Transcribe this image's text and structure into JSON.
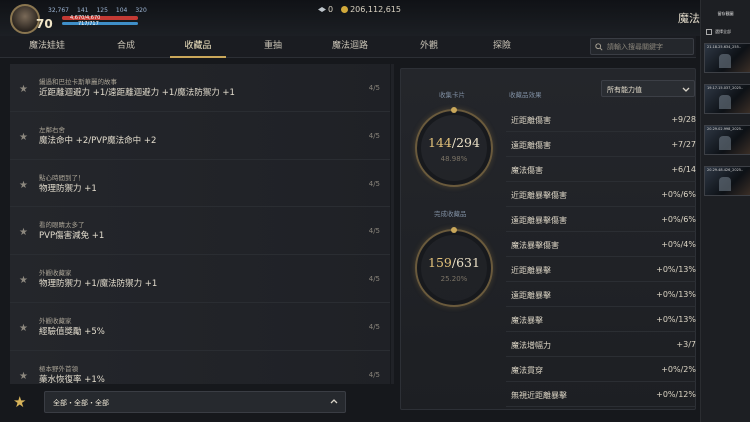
{
  "hud": {
    "level": "70",
    "stat_1": "32,767",
    "stat_2": "141",
    "stat_3": "125",
    "stat_4": "104",
    "stat_5": "320",
    "hp_text": "4,670/4,670",
    "hp_fraction": 1.0,
    "mp_text": "717/717",
    "mp_fraction": 1.0,
    "diamonds": "0",
    "gold": "206,112,615",
    "page_title": "魔法"
  },
  "tabs": [
    {
      "label": "魔法娃娃",
      "active": false
    },
    {
      "label": "合成",
      "active": false
    },
    {
      "label": "收藏品",
      "active": true
    },
    {
      "label": "重抽",
      "active": false
    },
    {
      "label": "魔法迴路",
      "active": false
    },
    {
      "label": "外觀",
      "active": false
    },
    {
      "label": "探險",
      "active": false
    }
  ],
  "search": {
    "placeholder": "請輸入搜尋關鍵字"
  },
  "collections": [
    {
      "name": "鑷過和巴拉卡斯華麗的故事",
      "effect": "近距離迴避力 +1/遠距離迴避力 +1/魔法防禦力 +1",
      "progress": "4/5"
    },
    {
      "name": "左鄰右舍",
      "effect": "魔法命中 +2/PVP魔法命中 +2",
      "progress": "4/5"
    },
    {
      "name": "點心時間到了！",
      "effect": "物理防禦力 +1",
      "progress": "4/5"
    },
    {
      "name": "看的眼睛太多了",
      "effect": "PVP傷害減免 +1",
      "progress": "4/5"
    },
    {
      "name": "外觀收藏家",
      "effect": "物理防禦力 +1/魔法防禦力 +1",
      "progress": "4/5"
    },
    {
      "name": "外觀收藏家",
      "effect": "經驗值獎勵 +5%",
      "progress": "4/5"
    },
    {
      "name": "極本野外首領",
      "effect": "藥水恢復率 +1%",
      "progress": "4/5"
    }
  ],
  "filter": {
    "label": "全部・全部・全部"
  },
  "panel": {
    "cards_label": "收集卡片",
    "cards_value": "144",
    "cards_total": "/294",
    "cards_pct": "48.98%",
    "complete_label": "完成收藏品",
    "complete_value": "159",
    "complete_total": "/631",
    "complete_pct": "25.20%",
    "effects_label": "收藏品效果",
    "dropdown": "所有能力值",
    "effects": [
      {
        "name": "近距離傷害",
        "value": "+9/28"
      },
      {
        "name": "遠距離傷害",
        "value": "+7/27"
      },
      {
        "name": "魔法傷害",
        "value": "+6/14"
      },
      {
        "name": "近距離暴擊傷害",
        "value": "+0%/6%"
      },
      {
        "name": "遠距離暴擊傷害",
        "value": "+0%/6%"
      },
      {
        "name": "魔法暴擊傷害",
        "value": "+0%/4%"
      },
      {
        "name": "近距離暴擊",
        "value": "+0%/13%"
      },
      {
        "name": "遠距離暴擊",
        "value": "+0%/13%"
      },
      {
        "name": "魔法暴擊",
        "value": "+0%/13%"
      },
      {
        "name": "魔法增幅力",
        "value": "+3/7"
      },
      {
        "name": "魔法貫穿",
        "value": "+0%/2%"
      },
      {
        "name": "無視近距離暴擊",
        "value": "+0%/12%"
      }
    ]
  },
  "strip": {
    "title": "留存截圖",
    "checkbox_label": "選擇全部",
    "thumbs": [
      "21.18.25.634_255..",
      "19.17.15.037_2025..",
      "20.29.02.998_2025..",
      "20.29.48.426_2025.."
    ]
  },
  "colors": {
    "accent_gold": "#c9a75a",
    "hp": "#c33a34",
    "mp": "#3f8fc9"
  },
  "icons": [
    "portrait-avatar",
    "diamond-icon",
    "gold-coin-icon",
    "search-icon",
    "star-icon",
    "chevron-up-icon",
    "chevron-down-icon",
    "checkbox-icon"
  ]
}
